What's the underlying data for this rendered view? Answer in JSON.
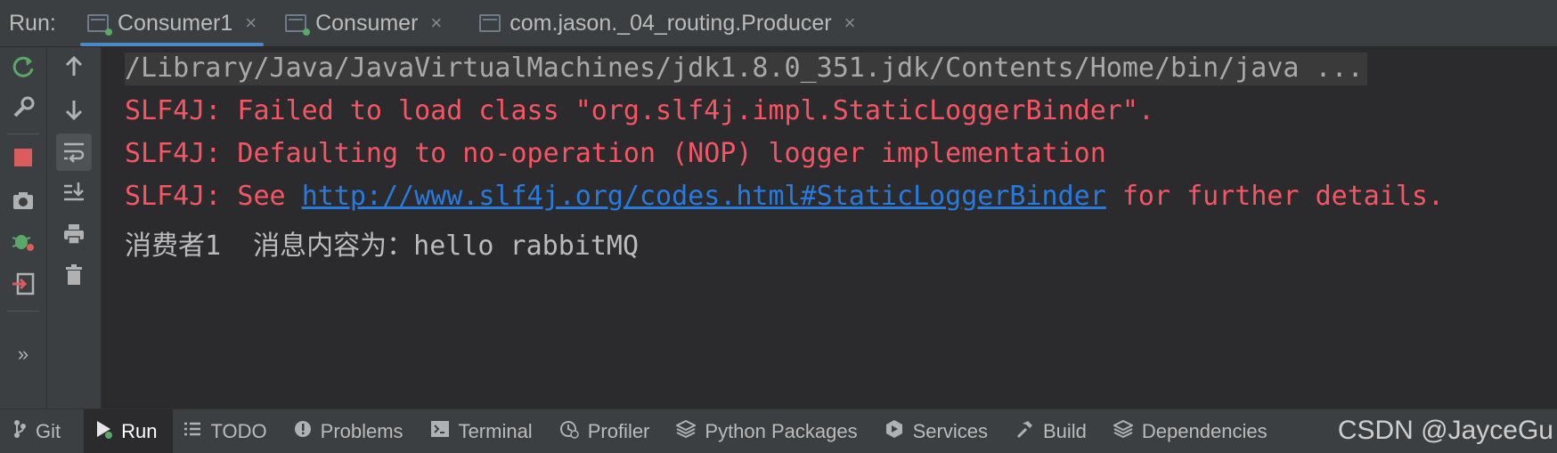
{
  "runbar": {
    "label": "Run:",
    "tabs": [
      {
        "label": "Consumer1",
        "active": true,
        "icon": "console-window-icon"
      },
      {
        "label": "Consumer",
        "active": false,
        "icon": "console-window-icon"
      },
      {
        "label": "com.jason._04_routing.Producer",
        "active": false,
        "icon": "console-window-icon"
      }
    ],
    "close_glyph": "×"
  },
  "console": {
    "lines": [
      {
        "kind": "command",
        "text": "/Library/Java/JavaVirtualMachines/jdk1.8.0_351.jdk/Contents/Home/bin/java ..."
      },
      {
        "kind": "error",
        "text": "SLF4J: Failed to load class \"org.slf4j.impl.StaticLoggerBinder\"."
      },
      {
        "kind": "error",
        "text": "SLF4J: Defaulting to no-operation (NOP) logger implementation"
      },
      {
        "kind": "error",
        "prefix": "SLF4J: See ",
        "link": "http://www.slf4j.org/codes.html#StaticLoggerBinder",
        "suffix": " for further details."
      },
      {
        "kind": "output",
        "text": "消费者1  消息内容为：hello rabbitMQ"
      }
    ]
  },
  "bottombar": {
    "items": [
      {
        "label": "Git",
        "icon": "branch-icon"
      },
      {
        "label": "Run",
        "icon": "run-icon",
        "active": true
      },
      {
        "label": "TODO",
        "icon": "list-icon"
      },
      {
        "label": "Problems",
        "icon": "warning-icon"
      },
      {
        "label": "Terminal",
        "icon": "terminal-icon"
      },
      {
        "label": "Profiler",
        "icon": "profiler-icon"
      },
      {
        "label": "Python Packages",
        "icon": "layers-icon"
      },
      {
        "label": "Services",
        "icon": "services-icon"
      },
      {
        "label": "Build",
        "icon": "hammer-icon"
      },
      {
        "label": "Dependencies",
        "icon": "layers-icon"
      }
    ]
  },
  "watermark": "CSDN @JayceGu",
  "colors": {
    "error": "#f75464",
    "link": "#287bde",
    "accent": "#4a88c7",
    "run_green": "#59a869"
  }
}
